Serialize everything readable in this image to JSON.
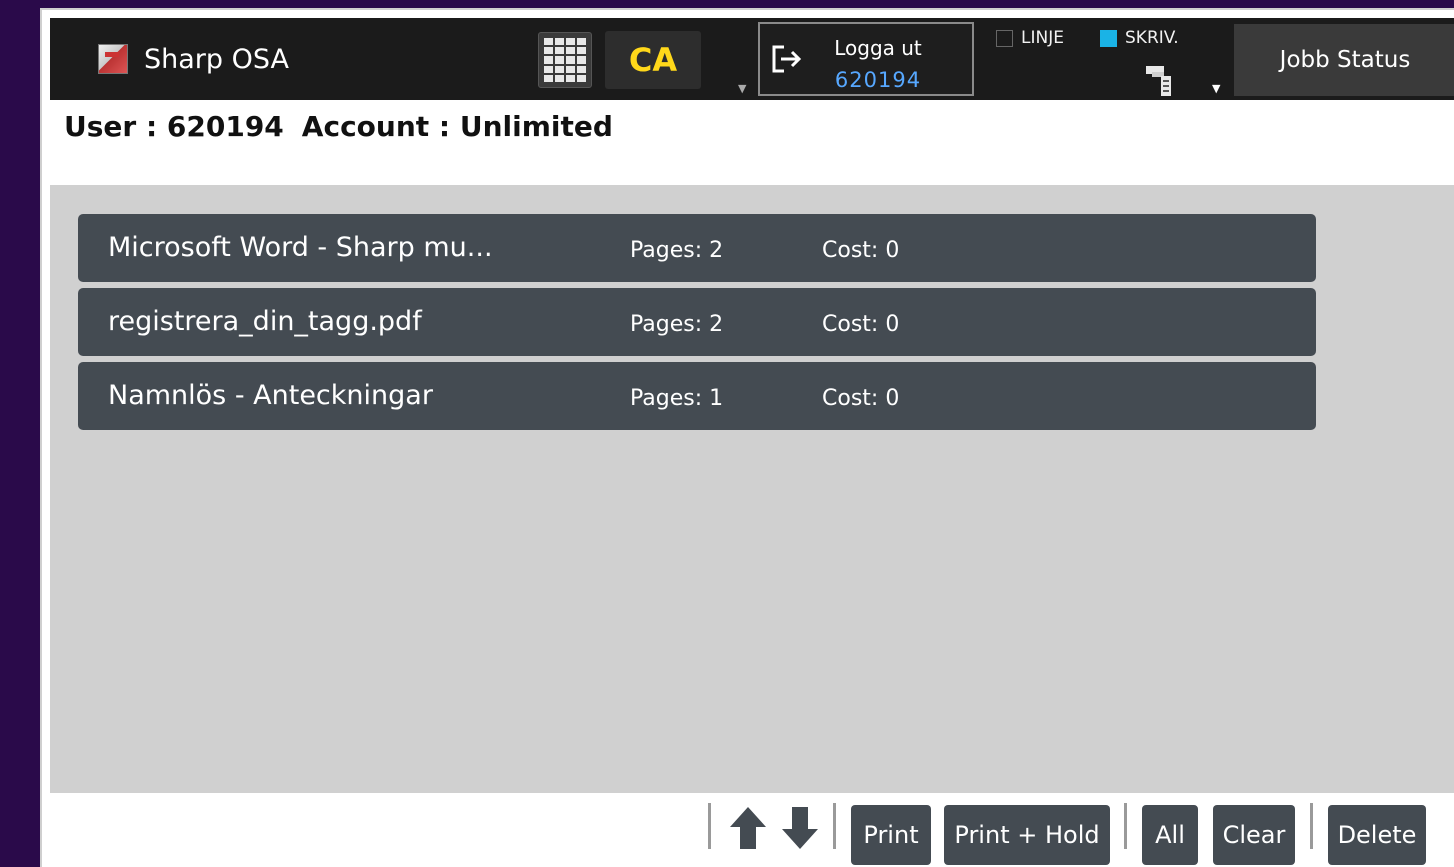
{
  "header": {
    "app_title": "Sharp OSA",
    "ca_label": "CA",
    "logout": {
      "label": "Logga ut",
      "user": "620194"
    },
    "modes": {
      "linje": "LINJE",
      "skriv": "SKRIV.",
      "skriv_active": true,
      "linje_active": false
    },
    "job_status_label": "Jobb Status"
  },
  "user_info": {
    "user": "User : 620194",
    "account": "Account : Unlimited"
  },
  "jobs": [
    {
      "name": "Microsoft Word - Sharp mu...",
      "pages": "Pages: 2",
      "cost": "Cost: 0"
    },
    {
      "name": "registrera_din_tagg.pdf",
      "pages": "Pages: 2",
      "cost": "Cost: 0"
    },
    {
      "name": "Namnlös - Anteckningar",
      "pages": "Pages: 1",
      "cost": "Cost: 0"
    }
  ],
  "toolbar": {
    "print": "Print",
    "print_hold": "Print + Hold",
    "all": "All",
    "clear": "Clear",
    "delete": "Delete"
  },
  "colors": {
    "accent_ca": "#ffd81a",
    "user_blue": "#57a8ff",
    "job_row": "#444b52",
    "active_mode": "#1ab3e6"
  }
}
